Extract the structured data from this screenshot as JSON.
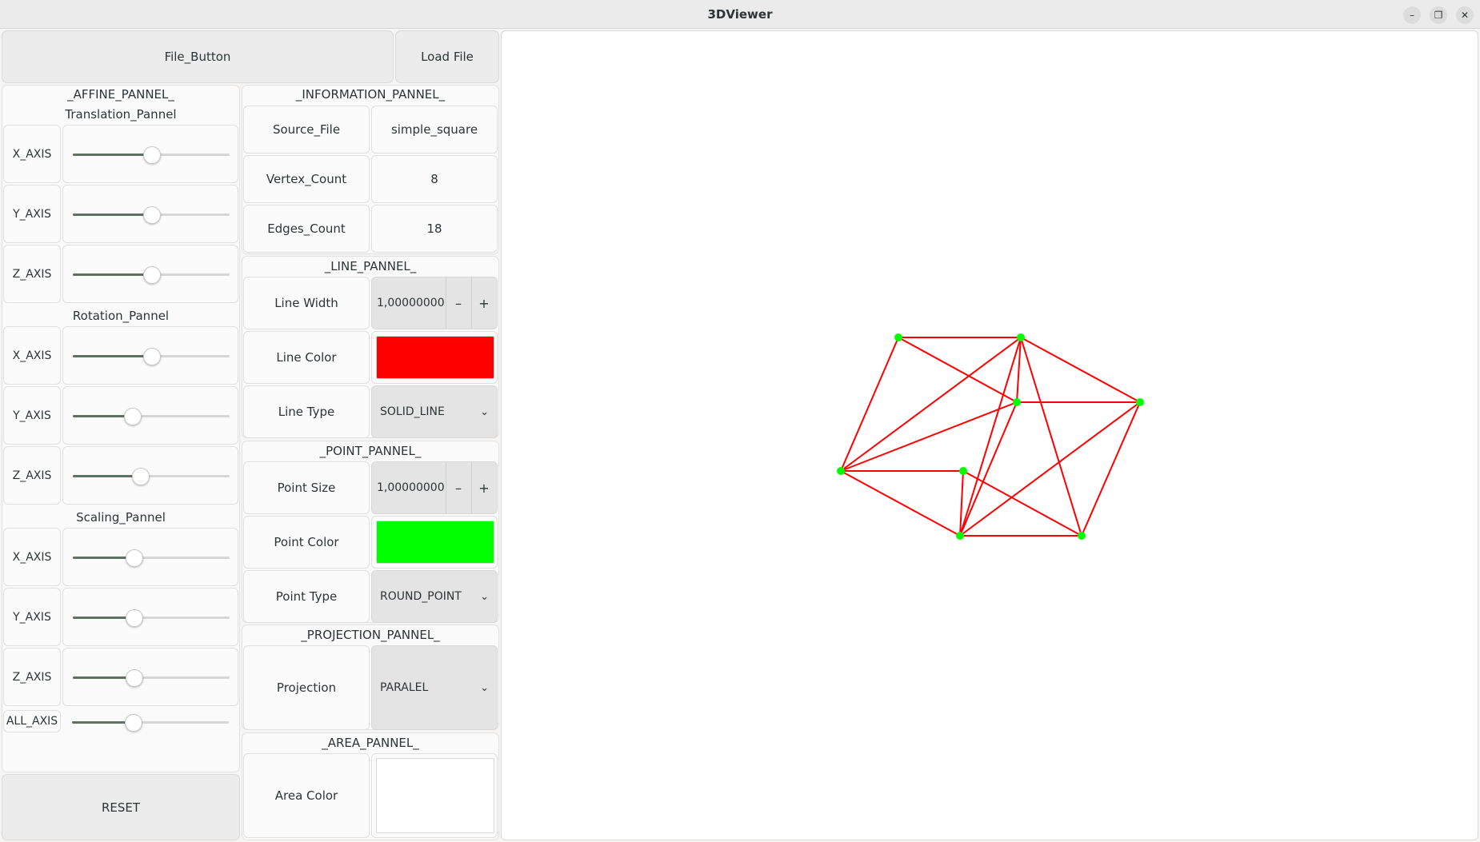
{
  "window": {
    "title": "3DViewer"
  },
  "window_controls": {
    "minimize": "–",
    "maximize": "❐",
    "close": "✕"
  },
  "top": {
    "file_button": "File_Button",
    "load_button": "Load File"
  },
  "affine": {
    "title": "_AFFINE_PANNEL_",
    "translation": {
      "title": "Translation_Pannel",
      "rows": [
        {
          "label": "X_AXIS",
          "value": 0.5
        },
        {
          "label": "Y_AXIS",
          "value": 0.5
        },
        {
          "label": "Z_AXIS",
          "value": 0.5
        }
      ]
    },
    "rotation": {
      "title": "Rotation_Pannel",
      "rows": [
        {
          "label": "X_AXIS",
          "value": 0.5
        },
        {
          "label": "Y_AXIS",
          "value": 0.38
        },
        {
          "label": "Z_AXIS",
          "value": 0.43
        }
      ]
    },
    "scaling": {
      "title": "Scaling_Pannel",
      "rows": [
        {
          "label": "X_AXIS",
          "value": 0.39
        },
        {
          "label": "Y_AXIS",
          "value": 0.39
        },
        {
          "label": "Z_AXIS",
          "value": 0.39
        }
      ],
      "all_axis": {
        "label": "ALL_AXIS",
        "value": 0.39
      }
    },
    "reset_button": "RESET"
  },
  "information": {
    "title": "_INFORMATION_PANNEL_",
    "rows": [
      {
        "label": "Source_File",
        "value": "simple_square"
      },
      {
        "label": "Vertex_Count",
        "value": "8"
      },
      {
        "label": "Edges_Count",
        "value": "18"
      }
    ]
  },
  "line": {
    "title": "_LINE_PANNEL_",
    "width_label": "Line Width",
    "width_value": "1,0000000000",
    "color_label": "Line Color",
    "color": "#ff0000",
    "type_label": "Line Type",
    "type_value": "SOLID_LINE"
  },
  "point": {
    "title": "_POINT_PANNEL_",
    "size_label": "Point Size",
    "size_value": "1,0000000000",
    "color_label": "Point Color",
    "color": "#00ff00",
    "type_label": "Point Type",
    "type_value": "ROUND_POINT"
  },
  "projection": {
    "title": "_PROJECTION_PANNEL_",
    "label": "Projection",
    "value": "PARALEL"
  },
  "area": {
    "title": "_AREA_PANNEL_",
    "color_label": "Area Color",
    "color": "#ffffff"
  },
  "spin_controls": {
    "minus": "–",
    "plus": "+",
    "chevron": "⌄"
  },
  "model": {
    "edge_color": "#ff0000",
    "vertex_color": "#00ff00",
    "vertex_count": 8,
    "edge_count": 18
  }
}
